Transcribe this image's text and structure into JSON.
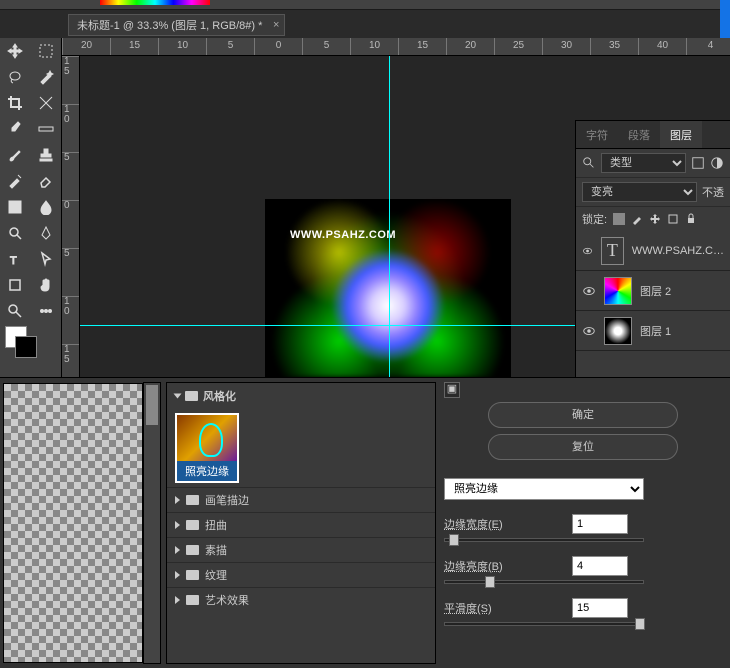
{
  "document": {
    "tab_title": "未标题-1 @ 33.3% (图层 1, RGB/8#) *",
    "watermark": "WWW.PSAHZ.COM"
  },
  "rulers": {
    "h": [
      "20",
      "15",
      "10",
      "5",
      "0",
      "5",
      "10",
      "15",
      "20",
      "25",
      "30",
      "35",
      "40",
      "4"
    ],
    "v": [
      "1\n5",
      "1\n0",
      "5",
      "0",
      "5",
      "1\n0",
      "1\n5"
    ]
  },
  "panels": {
    "tabs": {
      "char": "字符",
      "para": "段落",
      "layers": "图层"
    },
    "filter_label": "类型",
    "blend_mode": "变亮",
    "opacity_label": "不透",
    "lock_label": "锁定:",
    "layers": [
      {
        "name": "WWW.PSAHZ.C…",
        "type": "text"
      },
      {
        "name": "图层 2",
        "type": "rainbow"
      },
      {
        "name": "图层 1",
        "type": "bw"
      }
    ]
  },
  "filter_gallery": {
    "header": "风格化",
    "selected_thumb": "照亮边缘",
    "categories": [
      "画笔描边",
      "扭曲",
      "素描",
      "纹理",
      "艺术效果"
    ],
    "ok": "确定",
    "reset": "复位",
    "filter_name": "照亮边缘",
    "params": [
      {
        "label": "边缘宽度(E)",
        "value": "1",
        "pos": 2
      },
      {
        "label": "边缘亮度(B)",
        "value": "4",
        "pos": 20
      },
      {
        "label": "平滑度(S)",
        "value": "15",
        "pos": 96
      }
    ]
  }
}
